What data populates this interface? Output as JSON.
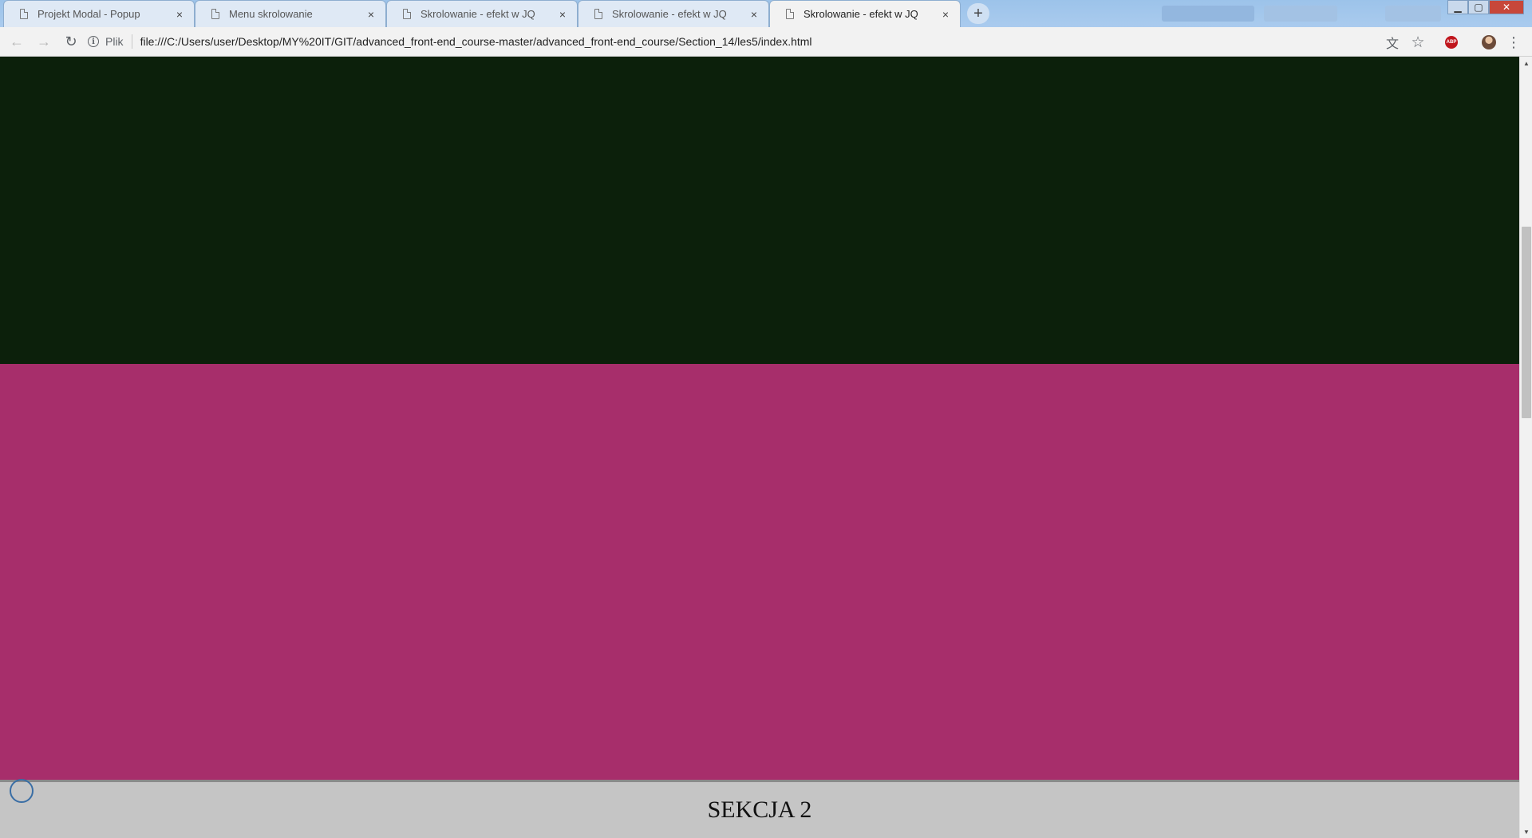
{
  "tabs": [
    {
      "title": "Projekt Modal - Popup",
      "close": "×",
      "active": false
    },
    {
      "title": "Menu skrolowanie",
      "close": "×",
      "active": false
    },
    {
      "title": "Skrolowanie - efekt w JQ",
      "close": "×",
      "active": false
    },
    {
      "title": "Skrolowanie - efekt w JQ",
      "close": "×",
      "active": false
    },
    {
      "title": "Skrolowanie - efekt w JQ",
      "close": "×",
      "active": true
    }
  ],
  "new_tab_label": "+",
  "window_controls": {
    "minimize": "▁",
    "maximize": "▢",
    "close": "✕"
  },
  "toolbar": {
    "back_icon": "←",
    "forward_icon": "→",
    "reload_icon": "↻",
    "info_icon": "i",
    "scheme_label": "Plik",
    "url": "file:///C:/Users/user/Desktop/MY%20IT/GIT/advanced_front-end_course-master/advanced_front-end_course/Section_14/les5/index.html",
    "translate_icon": "文",
    "bookmark_icon": "☆",
    "abp_label": "ABP",
    "menu_icon": "⋮"
  },
  "page": {
    "colors": {
      "dark_section": "#0c200b",
      "pink_section": "#a72e6b",
      "gray_section": "#c5c5c5"
    },
    "section_heading": "SEKCJA 2"
  },
  "scrollbar": {
    "up_arrow": "▲",
    "down_arrow": "▼"
  }
}
